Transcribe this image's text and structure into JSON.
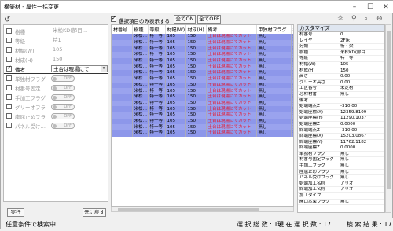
{
  "window": {
    "title": "構築材 - 属性一括変更"
  },
  "left_rows": [
    {
      "checked": false,
      "name": "樹種",
      "value": "米松KD(節目…",
      "type": "text",
      "disabled": true
    },
    {
      "checked": false,
      "name": "等級",
      "value": "特1",
      "type": "text",
      "disabled": true
    },
    {
      "checked": false,
      "name": "材幅(W)",
      "value": "105",
      "type": "text",
      "disabled": true
    },
    {
      "checked": false,
      "name": "材成(H)",
      "value": "150",
      "type": "text",
      "disabled": true
    },
    {
      "checked": true,
      "name": "備考",
      "value": "土台は現場にて",
      "type": "combo",
      "disabled": false
    },
    {
      "checked": false,
      "name": "単独材フラグ",
      "value": "OFF",
      "type": "toggle",
      "disabled": true
    },
    {
      "checked": false,
      "name": "材番号固定…",
      "value": "OFF",
      "type": "toggle",
      "disabled": true
    },
    {
      "checked": false,
      "name": "手加工フラグ",
      "value": "OFF",
      "type": "toggle",
      "disabled": true
    },
    {
      "checked": false,
      "name": "グリーオフラグ",
      "value": "OFF",
      "type": "toggle",
      "disabled": true
    },
    {
      "checked": false,
      "name": "座屈止めフラ…",
      "value": "OFF",
      "type": "toggle",
      "disabled": true
    },
    {
      "checked": false,
      "name": "パネル受け…",
      "value": "OFF",
      "type": "toggle",
      "disabled": true
    }
  ],
  "buttons": {
    "run": "実行",
    "undo": "元に戻す"
  },
  "toolbar": {
    "show_checked_only": "選択項目のみ表示する",
    "all_on": "全てON",
    "all_off": "全てOFF"
  },
  "grid": {
    "headers": [
      "材番号",
      "樹種",
      "等級",
      "材幅(W)",
      "材成(H)",
      "備考",
      "単独材フラグ",
      "材番"
    ],
    "rows": [
      [
        "",
        "米松…",
        "特一等",
        "105",
        "150",
        "土台は現場にてカット",
        "無し",
        "無"
      ],
      [
        "",
        "米松…",
        "特一等",
        "105",
        "150",
        "土台は現場にてカット",
        "無し",
        "無"
      ],
      [
        "",
        "米松…",
        "特一等",
        "105",
        "150",
        "土台は現場にてカット",
        "無し",
        "無"
      ],
      [
        "",
        "米松…",
        "特一等",
        "105",
        "150",
        "土台は現場にてカット",
        "無し",
        "無"
      ],
      [
        "",
        "米松…",
        "特一等",
        "105",
        "150",
        "土台は現場にてカット",
        "無し",
        "無"
      ],
      [
        "",
        "米松…",
        "特一等",
        "105",
        "150",
        "土台は現場にてカット",
        "無し",
        "無"
      ],
      [
        "",
        "米松…",
        "特一等",
        "105",
        "150",
        "土台は現場にてカット",
        "無し",
        "無"
      ],
      [
        "",
        "米松…",
        "特一等",
        "105",
        "150",
        "土台は現場にてカット",
        "無し",
        "無"
      ],
      [
        "",
        "米松…",
        "特一等",
        "105",
        "150",
        "土台は現場にてカット",
        "無し",
        "無"
      ],
      [
        "",
        "米松…",
        "特一等",
        "105",
        "150",
        "土台は現場にてカット",
        "無し",
        "無"
      ],
      [
        "",
        "米松…",
        "特一等",
        "105",
        "150",
        "土台は現場にてカット",
        "無し",
        "無"
      ],
      [
        "",
        "米松…",
        "特一等",
        "105",
        "150",
        "土台は現場にてカット",
        "無し",
        "無"
      ],
      [
        "",
        "米松…",
        "特一等",
        "105",
        "150",
        "土台は現場にてカット",
        "無し",
        "無"
      ],
      [
        "",
        "米松…",
        "特一等",
        "105",
        "150",
        "土台は現場にてカット",
        "無し",
        "無"
      ],
      [
        "",
        "米松…",
        "特一等",
        "105",
        "150",
        "土台は現場にてカット",
        "無し",
        "無"
      ],
      [
        "",
        "米松…",
        "特一等",
        "105",
        "150",
        "土台は現場にてカット",
        "無し",
        "無"
      ],
      [
        "",
        "米松…",
        "特一等",
        "105",
        "150",
        "土台は現場にてカット",
        "無し",
        "無"
      ]
    ]
  },
  "custom_panel": {
    "title": "カスタマイズ",
    "rows": [
      [
        "材番号",
        "0"
      ],
      [
        "レイヤ",
        "2F床"
      ],
      [
        "分類",
        "桁・梁"
      ],
      [
        "樹種",
        "米松KD(節目..."
      ],
      [
        "等級",
        "特一等"
      ],
      [
        "材幅(W)",
        "105"
      ],
      [
        "材成(H)",
        "150"
      ],
      [
        "高さ",
        "0.00"
      ],
      [
        "グリーオ高さ",
        "0.00"
      ],
      [
        "工区番号",
        "未定材"
      ],
      [
        "芯材材番",
        "無し"
      ],
      [
        "備考",
        ""
      ],
      [
        "始端端点Z",
        "-310.00"
      ],
      [
        "始端座標(X)",
        "12359.8109"
      ],
      [
        "始端座標(Y)",
        "11290.1037"
      ],
      [
        "始端座標Z",
        "0.0000"
      ],
      [
        "終端端点Z",
        "-310.00"
      ],
      [
        "終端座標(X)",
        "15203.0867"
      ],
      [
        "終端座標(Y)",
        "11762.1182"
      ],
      [
        "終端座標Z",
        "0.0000"
      ],
      [
        "単独材フラグ",
        "無し"
      ],
      [
        "材番号固定フラグ",
        "無し"
      ],
      [
        "手加工フラグ",
        "無し"
      ],
      [
        "座屈止めフラグ",
        "無し"
      ],
      [
        "パネル受けフラグ",
        "無し"
      ],
      [
        "始端加工名称",
        "アリオ"
      ],
      [
        "終端加工名称",
        "アリオ"
      ],
      [
        "加工タイプ",
        ""
      ],
      [
        "開口本束フラグ",
        "無し"
      ]
    ]
  },
  "status": {
    "mode": "任意条件で検索中",
    "selected": "選 択 総 数 : 17",
    "current": "現 在 選 択 数 : 17",
    "results": "検 索 結 果 : 17"
  }
}
